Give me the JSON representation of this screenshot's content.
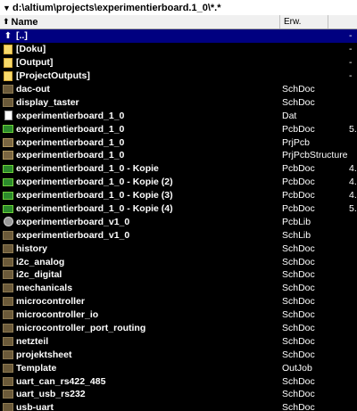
{
  "path": {
    "value": "d:\\altium\\projects\\experimentierboard.1_0\\*.*"
  },
  "header": {
    "name_label": "Name",
    "ext_label": "Erw."
  },
  "rows": [
    {
      "name": "[..]",
      "ext": "",
      "size": "-",
      "icon": "up-folder-icon",
      "selected": true
    },
    {
      "name": "[Doku]",
      "ext": "",
      "size": "-",
      "icon": "folder-icon"
    },
    {
      "name": "[Output]",
      "ext": "",
      "size": "-",
      "icon": "folder-icon"
    },
    {
      "name": "[ProjectOutputs]",
      "ext": "",
      "size": "-",
      "icon": "folder-icon"
    },
    {
      "name": "dac-out",
      "ext": "SchDoc",
      "size": "",
      "icon": "schematic-icon"
    },
    {
      "name": "display_taster",
      "ext": "SchDoc",
      "size": "",
      "icon": "schematic-icon"
    },
    {
      "name": "experimentierboard_1_0",
      "ext": "Dat",
      "size": "",
      "icon": "document-icon"
    },
    {
      "name": "experimentierboard_1_0",
      "ext": "PcbDoc",
      "size": "5.",
      "icon": "pcb-icon"
    },
    {
      "name": "experimentierboard_1_0",
      "ext": "PrjPcb",
      "size": "",
      "icon": "project-icon"
    },
    {
      "name": "experimentierboard_1_0",
      "ext": "PrjPcbStructure",
      "size": "",
      "icon": "project-icon"
    },
    {
      "name": "experimentierboard_1_0 - Kopie",
      "ext": "PcbDoc",
      "size": "4.",
      "icon": "pcb-icon"
    },
    {
      "name": "experimentierboard_1_0 - Kopie (2)",
      "ext": "PcbDoc",
      "size": "4.",
      "icon": "pcb-icon"
    },
    {
      "name": "experimentierboard_1_0 - Kopie (3)",
      "ext": "PcbDoc",
      "size": "4.",
      "icon": "pcb-icon"
    },
    {
      "name": "experimentierboard_1_0 - Kopie (4)",
      "ext": "PcbDoc",
      "size": "5.",
      "icon": "pcb-icon"
    },
    {
      "name": "experimentierboard_v1_0",
      "ext": "PcbLib",
      "size": "",
      "icon": "pcblib-icon"
    },
    {
      "name": "experimentierboard_v1_0",
      "ext": "SchLib",
      "size": "",
      "icon": "schematic-icon"
    },
    {
      "name": "history",
      "ext": "SchDoc",
      "size": "",
      "icon": "schematic-icon"
    },
    {
      "name": "i2c_analog",
      "ext": "SchDoc",
      "size": "",
      "icon": "schematic-icon"
    },
    {
      "name": "i2c_digital",
      "ext": "SchDoc",
      "size": "",
      "icon": "schematic-icon"
    },
    {
      "name": "mechanicals",
      "ext": "SchDoc",
      "size": "",
      "icon": "schematic-icon"
    },
    {
      "name": "microcontroller",
      "ext": "SchDoc",
      "size": "",
      "icon": "schematic-icon"
    },
    {
      "name": "microcontroller_io",
      "ext": "SchDoc",
      "size": "",
      "icon": "schematic-icon"
    },
    {
      "name": "microcontroller_port_routing",
      "ext": "SchDoc",
      "size": "",
      "icon": "schematic-icon"
    },
    {
      "name": "netzteil",
      "ext": "SchDoc",
      "size": "",
      "icon": "schematic-icon"
    },
    {
      "name": "projektsheet",
      "ext": "SchDoc",
      "size": "",
      "icon": "schematic-icon"
    },
    {
      "name": "Template",
      "ext": "OutJob",
      "size": "",
      "icon": "schematic-icon"
    },
    {
      "name": "uart_can_rs422_485",
      "ext": "SchDoc",
      "size": "",
      "icon": "schematic-icon"
    },
    {
      "name": "uart_usb_rs232",
      "ext": "SchDoc",
      "size": "",
      "icon": "schematic-icon"
    },
    {
      "name": "usb-uart",
      "ext": "SchDoc",
      "size": "",
      "icon": "schematic-icon"
    }
  ],
  "colors": {
    "background": "#000000",
    "selection": "#000080",
    "text": "#ffffff"
  }
}
